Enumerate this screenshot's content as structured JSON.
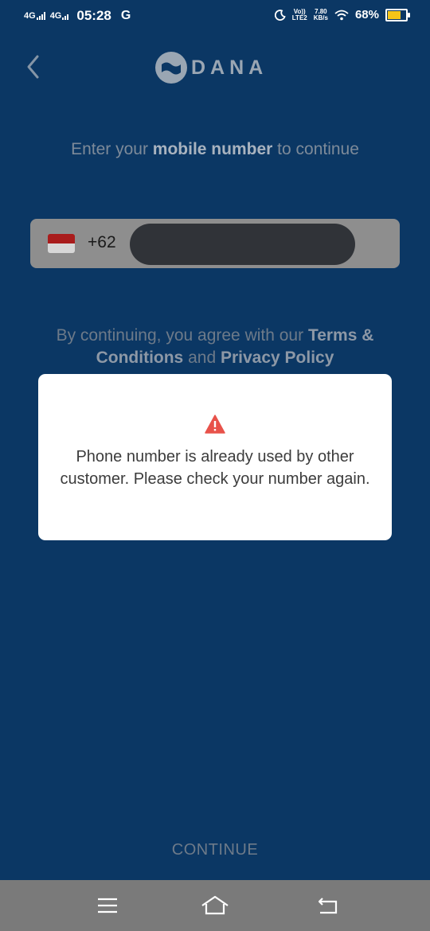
{
  "status_bar": {
    "network_1": "4G",
    "network_2": "4G",
    "time": "05:28",
    "carrier_indicator": "G",
    "volte_top": "Vo))",
    "volte_bottom": "LTE2",
    "speed_value": "7.80",
    "speed_unit": "KB/s",
    "battery_percent": "68%",
    "battery_level": 0.68,
    "battery_color": "#f5c518"
  },
  "header": {
    "back_icon": "chevron-left-icon",
    "logo_text": "DANA"
  },
  "login": {
    "prompt_pre": "Enter your ",
    "prompt_bold": "mobile number",
    "prompt_post": " to continue",
    "country_code": "+62",
    "phone_value": "",
    "terms_pre": "By continuing, you agree with our ",
    "terms_link": "Terms & Conditions",
    "terms_mid": " and ",
    "privacy_link": "Privacy Policy"
  },
  "dialog": {
    "icon": "warning-icon",
    "icon_color": "#e8524a",
    "message": "Phone number is already used by other customer. Please check your number again."
  },
  "footer": {
    "continue_label": "CONTINUE"
  },
  "nav_bar": {
    "menu_icon": "menu-icon",
    "home_icon": "home-icon",
    "back_icon": "back-icon"
  },
  "colors": {
    "background": "#0b3764",
    "dialog_bg": "#ffffff"
  }
}
